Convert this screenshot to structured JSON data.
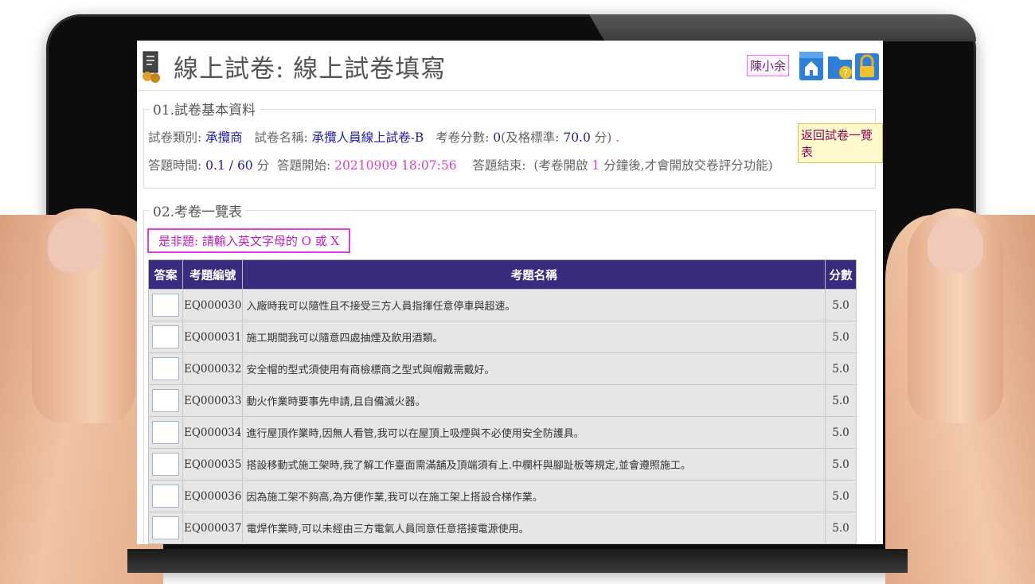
{
  "header": {
    "title": "線上試卷: 線上試卷填寫",
    "user_name": "陳小余",
    "icons": [
      "home-icon",
      "help-icon",
      "lock-icon"
    ]
  },
  "section1": {
    "title": "01.試卷基本資料",
    "category_label": "試卷類別:",
    "category_value": "承攬商",
    "name_label": "試卷名稱:",
    "name_value": "承攬人員線上試卷-B",
    "score_label": "考卷分數:",
    "score_value": "0",
    "pass_label": "(及格標準:",
    "pass_value": "70.0",
    "pass_suffix": "分)",
    "dot": ".",
    "back_button": "返回試卷一覽表",
    "time_label": "答題時間:",
    "time_used": "0.1",
    "time_sep": "/",
    "time_total": "60",
    "time_unit": "分",
    "start_label": "答題開始:",
    "start_value": "20210909 18:07:56",
    "end_label": "答題結束:",
    "end_note_pre": "(考卷開啟",
    "end_note_num": "1",
    "end_note_post": "分鐘後,才會開放交卷評分功能)"
  },
  "section2": {
    "title": "02.考卷一覽表",
    "hint": "是非題: 請輸入英文字母的 O 或 X"
  },
  "table": {
    "headers": [
      "答案",
      "考題編號",
      "考題名稱",
      "分數"
    ],
    "rows": [
      {
        "id": "EQ000030",
        "name": "入廠時我可以隨性且不接受三方人員指揮任意停車與超速。",
        "score": "5.0"
      },
      {
        "id": "EQ000031",
        "name": "施工期間我可以隨意四處抽煙及飲用酒類。",
        "score": "5.0"
      },
      {
        "id": "EQ000032",
        "name": "安全帽的型式須使用有商檢標商之型式與帽戴需戴好。",
        "score": "5.0"
      },
      {
        "id": "EQ000033",
        "name": "動火作業時要事先申請,且自備滅火器。",
        "score": "5.0"
      },
      {
        "id": "EQ000034",
        "name": "進行屋頂作業時,因無人看管,我可以在屋頂上吸煙與不必使用安全防護具。",
        "score": "5.0"
      },
      {
        "id": "EQ000035",
        "name": "搭設移動式施工架時,我了解工作臺面需滿舖及頂端須有上.中欄杆與腳趾板等規定,並會遵照施工。",
        "score": "5.0"
      },
      {
        "id": "EQ000036",
        "name": "因為施工架不夠高,為方便作業,我可以在施工架上搭設合梯作業。",
        "score": "5.0"
      },
      {
        "id": "EQ000037",
        "name": "電焊作業時,可以未經由三方電氣人員同意任意搭接電源使用。",
        "score": "5.0"
      }
    ]
  }
}
